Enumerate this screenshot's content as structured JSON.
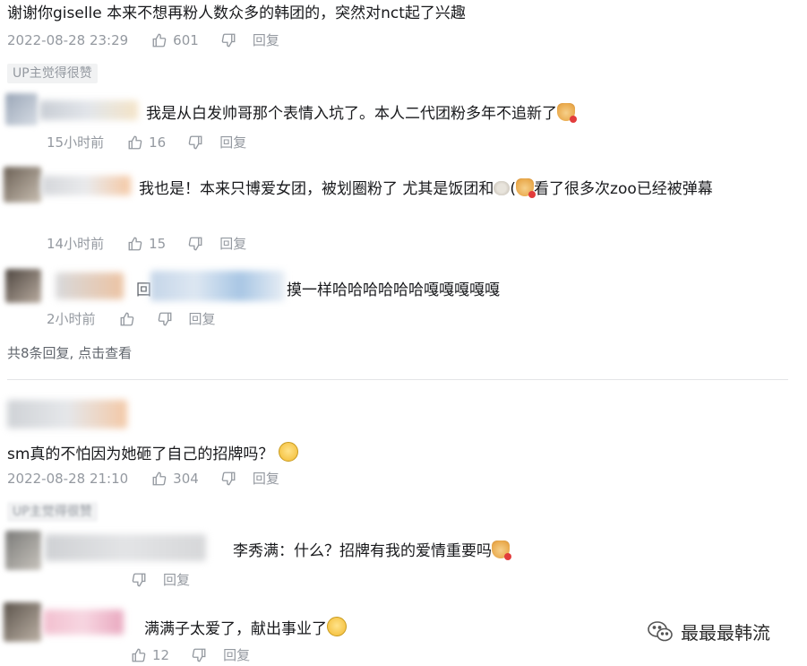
{
  "comment1": {
    "text": "谢谢你giselle 本来不想再粉人数众多的韩团的，突然对nct起了兴趣",
    "time": "2022-08-28 23:29",
    "likes": "601",
    "reply_label": "回复",
    "up_badge": "UP主觉得很赞",
    "replies": [
      {
        "text": "我是从白发帅哥那个表情入坑了。本人二代团粉多年不追新了",
        "time": "15小时前",
        "likes": "16",
        "reply_label": "回复"
      },
      {
        "text_a": "我也是！本来只博爱女团，被划圈粉了 尤其是饭团和",
        "text_b": "(",
        "text_c": "看了很多次zoo已经被弹幕",
        "time": "14小时前",
        "likes": "15",
        "reply_label": "回复"
      },
      {
        "prefix": "回",
        "text": "摸一样哈哈哈哈哈哈嘎嘎嘎嘎嘎",
        "time": "2小时前",
        "reply_label": "回复"
      }
    ],
    "view_more": "共8条回复, 点击查看"
  },
  "comment2": {
    "text": "sm真的不怕因为她砸了自己的招牌吗？",
    "time": "2022-08-28 21:10",
    "likes": "304",
    "reply_label": "回复",
    "up_badge": "UP主觉得很赞",
    "replies": [
      {
        "text": "李秀满：什么？招牌有我的爱情重要吗",
        "reply_label": "回复"
      },
      {
        "text": "满满子太爱了，献出事业了",
        "likes": "12",
        "reply_label": "回复"
      }
    ]
  },
  "watermark": {
    "text": "最最最韩流"
  },
  "colors": {
    "text": "#18191c",
    "meta": "#9499a0",
    "badge_bg": "#f1f2f3"
  },
  "icons": {
    "like": "thumbs-up-icon",
    "dislike": "thumbs-down-icon",
    "wechat": "wechat-icon"
  }
}
